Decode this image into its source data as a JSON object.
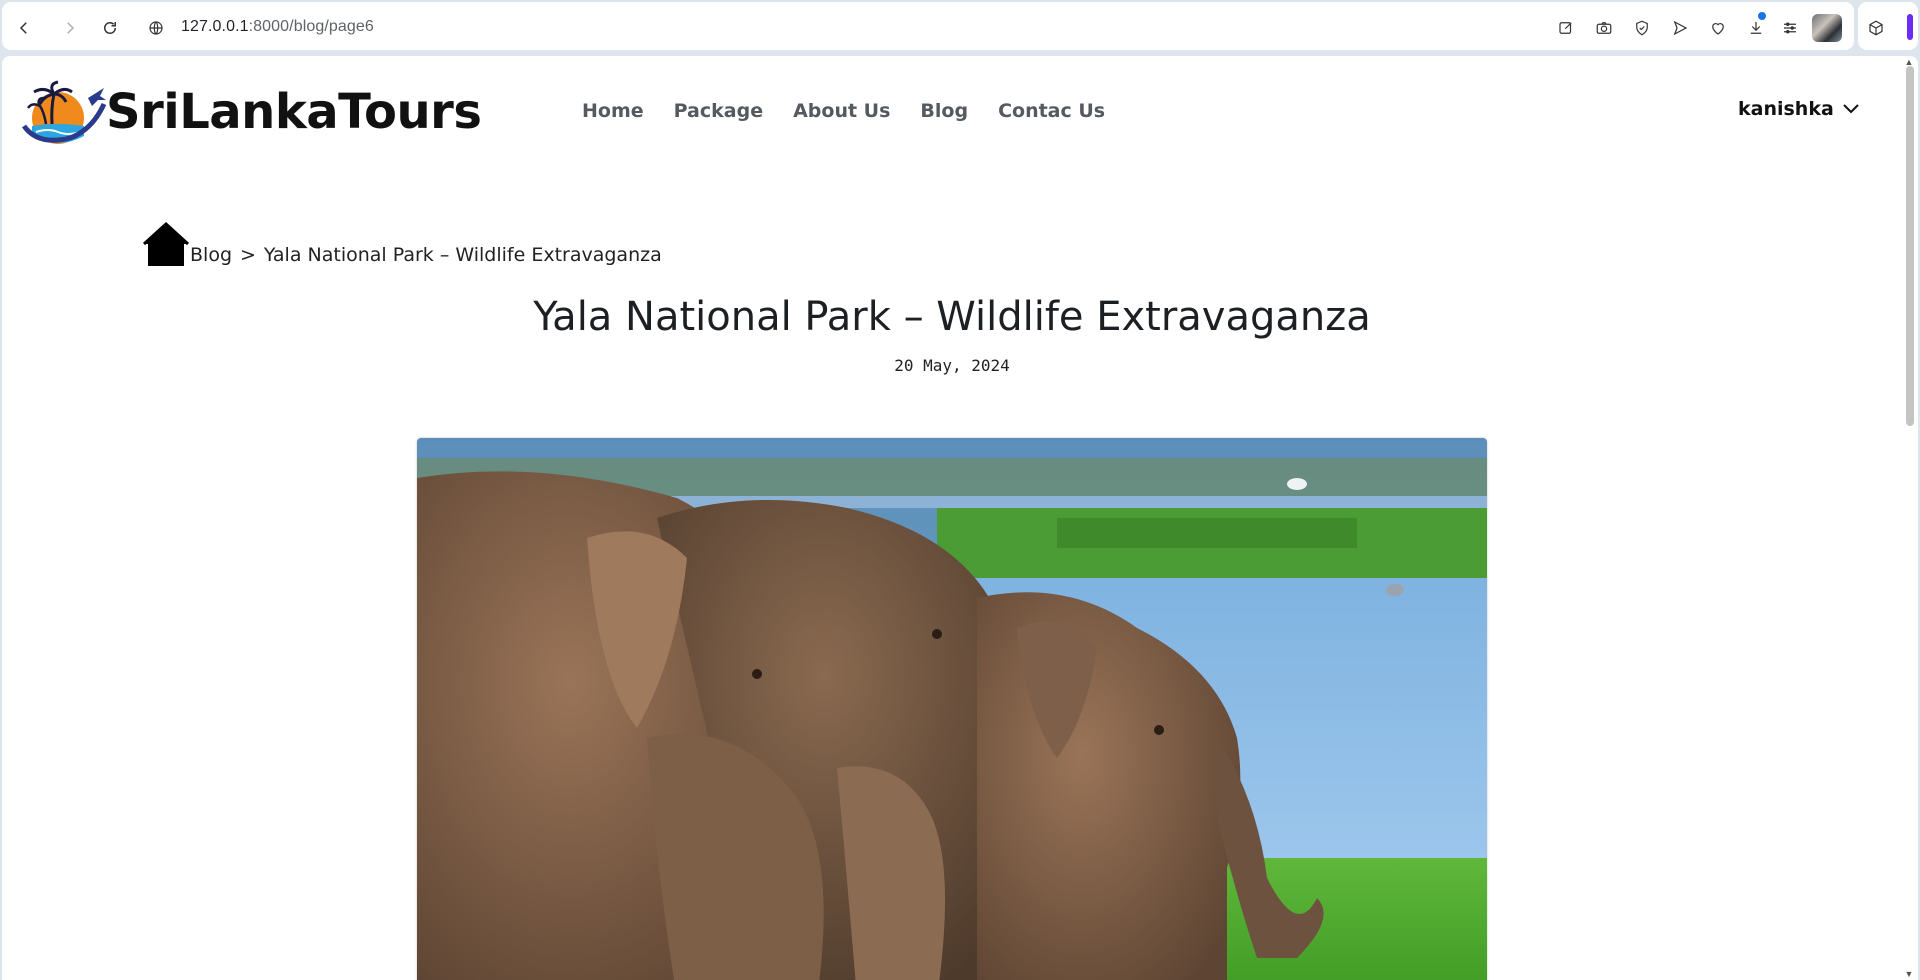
{
  "browser": {
    "url_host": "127.0.0.1",
    "url_rest": ":8000/blog/page6",
    "toolbar_icons": [
      "edit-icon",
      "camera-icon",
      "shield-icon",
      "send-icon",
      "heart-icon",
      "download-icon",
      "menu-icon",
      "profile-avatar",
      "extensions-cube-icon"
    ]
  },
  "site": {
    "brand": "SriLankaTours",
    "nav": {
      "home": "Home",
      "package": "Package",
      "about": "About Us",
      "blog": "Blog",
      "contact": "Contac Us"
    },
    "user": "kanishka"
  },
  "breadcrumb": {
    "blog": "Blog",
    "separator": ">",
    "current": "Yala National Park – Wildlife Extravaganza"
  },
  "post": {
    "title": "Yala National Park – Wildlife Extravaganza",
    "date": "20 May, 2024"
  },
  "colors": {
    "accent_purple": "#6b2cf5",
    "logo_orange": "#f08a1c",
    "logo_navy": "#2a3a8c",
    "logo_blue": "#2aa7e0"
  }
}
